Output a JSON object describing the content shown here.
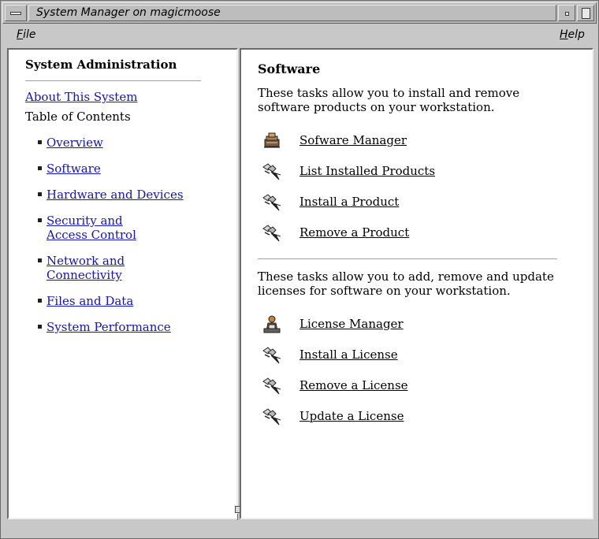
{
  "window": {
    "title": "System Manager on magicmoose"
  },
  "menubar": {
    "file": {
      "mnemonic": "F",
      "rest": "ile"
    },
    "help": {
      "mnemonic": "H",
      "rest": "elp"
    }
  },
  "left": {
    "title": "System Administration",
    "about_link": "About This System",
    "toc_label": "Table of Contents",
    "toc": [
      "Overview",
      "Software",
      "Hardware and Devices",
      "Security and Access Control",
      "Network and Connectivity",
      "Files and Data",
      "System Performance"
    ]
  },
  "right": {
    "title": "Software",
    "software_desc": "These tasks allow you to install and remove software products on your workstation.",
    "software_tasks": [
      {
        "label": "Sofware Manager",
        "icon": "software-manager-icon"
      },
      {
        "label": "List Installed Products",
        "icon": "task-launch-icon"
      },
      {
        "label": "Install a Product",
        "icon": "task-launch-icon"
      },
      {
        "label": "Remove a Product",
        "icon": "task-launch-icon"
      }
    ],
    "license_desc": "These tasks allow you to add, remove and update licenses for software on your workstation.",
    "license_tasks": [
      {
        "label": "License Manager",
        "icon": "license-manager-icon"
      },
      {
        "label": "Install a License",
        "icon": "task-launch-icon"
      },
      {
        "label": "Remove a License",
        "icon": "task-launch-icon"
      },
      {
        "label": "Update a License",
        "icon": "task-launch-icon"
      }
    ]
  },
  "colors": {
    "link": "#1212c8",
    "chrome": "#c8c8c8",
    "pane_bg": "#ffffff"
  }
}
